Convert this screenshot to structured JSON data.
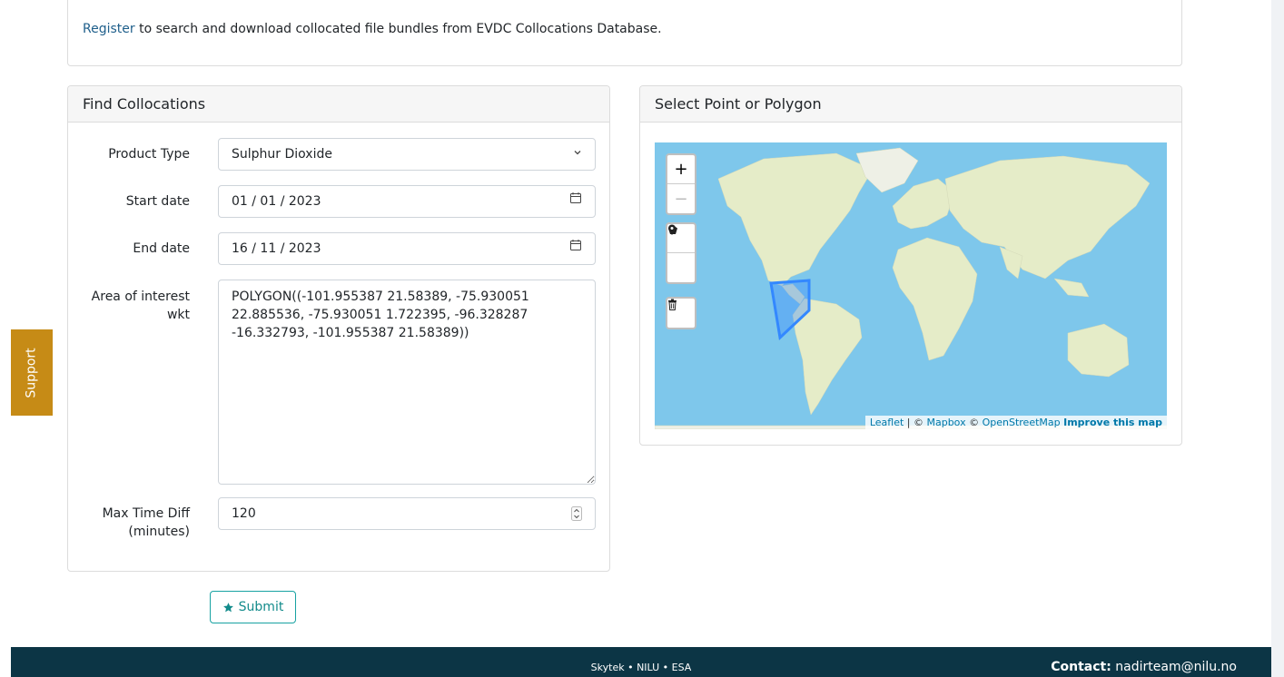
{
  "notice": {
    "link": "Register",
    "text": " to search and download collocated file bundles from EVDC Collocations Database."
  },
  "find": {
    "title": "Find Collocations",
    "product_type_label": "Product Type",
    "product_type_value": "Sulphur Dioxide",
    "start_label": "Start date",
    "start_value": "01 / 01 / 2023",
    "end_label": "End date",
    "end_value": "16 / 11 / 2023",
    "aoi_label_1": "Area of interest",
    "aoi_label_2": "wkt",
    "aoi_value": "POLYGON((-101.955387 21.58389, -75.930051 22.885536, -75.930051 1.722395, -96.328287 -16.332793, -101.955387 21.58389))",
    "maxtime_label_1": "Max Time Diff",
    "maxtime_label_2": "(minutes)",
    "maxtime_value": "120"
  },
  "submit": {
    "label": "Submit"
  },
  "map_card": {
    "title": "Select Point or Polygon",
    "zoom_in": "+",
    "zoom_out": "−",
    "attrib_leaflet": "Leaflet",
    "attrib_sep": " | © ",
    "attrib_mapbox": "Mapbox",
    "attrib_copy": " © ",
    "attrib_osm": "OpenStreetMap",
    "attrib_improve": "Improve this map"
  },
  "support": {
    "label": "Support"
  },
  "footer": {
    "credits": "Skytek • NILU • ESA",
    "contact_label": "Contact:",
    "contact_email": "nadirteam@nilu.no"
  },
  "colors": {
    "accent_teal": "#17a2a2",
    "support_orange": "#c68b16",
    "footer_navy": "#0c3545",
    "polygon_blue": "#3388ff"
  },
  "icons": [
    "calendar-icon",
    "chevron-down-icon",
    "spinner-icon",
    "star-icon",
    "polygon-icon",
    "marker-icon",
    "trash-icon"
  ]
}
